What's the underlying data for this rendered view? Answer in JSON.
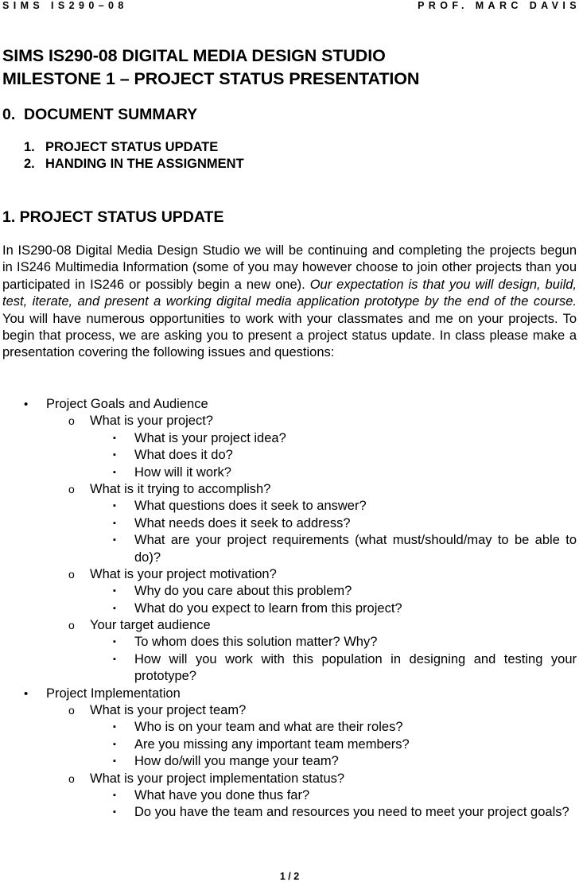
{
  "header": {
    "left": "SIMS IS290–08",
    "right": "PROF. MARC DAVIS"
  },
  "title": {
    "line1": "SIMS IS290-08 DIGITAL MEDIA DESIGN STUDIO",
    "line2": "MILESTONE 1 – PROJECT STATUS PRESENTATION"
  },
  "summary": {
    "number": "0.",
    "heading": "DOCUMENT SUMMARY",
    "items": [
      {
        "num": "1.",
        "label": "PROJECT STATUS UPDATE"
      },
      {
        "num": "2.",
        "label": "HANDING IN THE ASSIGNMENT"
      }
    ]
  },
  "section1": {
    "heading": "1. PROJECT STATUS UPDATE",
    "intro_part1": "In IS290-08 Digital Media Design Studio we will be continuing and completing the projects begun in IS246 Multimedia Information (some of you may however choose to join other projects than you participated in IS246 or possibly begin a new one).  ",
    "intro_italic": "Our expectation is that you will design, build, test, iterate, and present a working digital media application prototype by the end of the course.",
    "intro_part2": "  You will have numerous opportunities to work with your classmates and me on your projects.  To begin that process, we are asking you to present a project status update.  In class please make a presentation covering the following issues and questions:"
  },
  "markers": {
    "l1": "•",
    "l2": "o",
    "l3": "▪"
  },
  "outline": {
    "goals": {
      "label": "Project Goals and Audience",
      "q_project": {
        "label": "What is your project?",
        "items": [
          "What is your project idea?",
          "What does it do?",
          "How will it work?"
        ]
      },
      "q_accomplish": {
        "label": "What is it trying to accomplish?",
        "items": [
          "What questions does it seek to answer?",
          "What needs does it seek to address?",
          "What are your project requirements (what must/should/may to be able to do)?"
        ]
      },
      "q_motivation": {
        "label": "What is your project motivation?",
        "items": [
          "Why do you care about this problem?",
          "What do you expect to learn from this project?"
        ]
      },
      "q_audience": {
        "label": "Your target audience",
        "items": [
          "To whom does this solution matter? Why?",
          "How will you work with this population in designing and testing your prototype?"
        ]
      }
    },
    "implementation": {
      "label": "Project Implementation",
      "q_team": {
        "label": "What is your project team?",
        "items": [
          "Who is on your team and what are their roles?",
          "Are you missing any important team members?",
          "How do/will you mange your team?"
        ]
      },
      "q_status": {
        "label": "What is your project implementation status?",
        "items": [
          "What have you done thus far?",
          "Do you have the team and resources you need to meet your project goals?"
        ]
      }
    }
  },
  "footer": {
    "page": "1 / 2"
  }
}
